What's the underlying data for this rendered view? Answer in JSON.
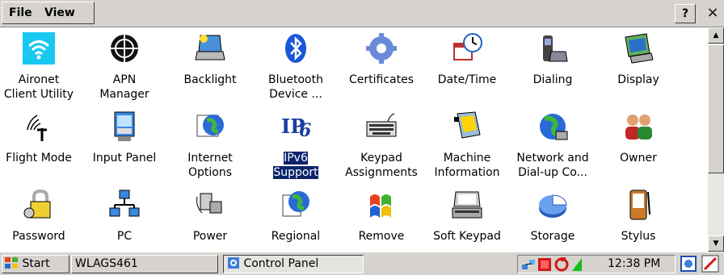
{
  "menubar": {
    "file": "File",
    "view": "View",
    "help": "?",
    "close": "×"
  },
  "items": [
    {
      "label": "Aironet\nClient Utility",
      "icon": "wifi-icon",
      "selected": false
    },
    {
      "label": "APN\nManager",
      "icon": "apn-globe-icon",
      "selected": false
    },
    {
      "label": "Backlight",
      "icon": "backlight-laptop-icon",
      "selected": false
    },
    {
      "label": "Bluetooth\nDevice ...",
      "icon": "bluetooth-icon",
      "selected": false
    },
    {
      "label": "Certificates",
      "icon": "certificates-gear-icon",
      "selected": false
    },
    {
      "label": "Date/Time",
      "icon": "date-time-clock-icon",
      "selected": false
    },
    {
      "label": "Dialing",
      "icon": "dialing-phone-icon",
      "selected": false
    },
    {
      "label": "Display",
      "icon": "display-monitor-icon",
      "selected": false
    },
    {
      "label": "Flight Mode",
      "icon": "flight-mode-antenna-icon",
      "selected": false
    },
    {
      "label": "Input Panel",
      "icon": "input-panel-icon",
      "selected": false
    },
    {
      "label": "Internet\nOptions",
      "icon": "internet-options-globe-icon",
      "selected": false
    },
    {
      "label": "IPv6\nSupport",
      "icon": "ipv6-icon",
      "selected": true
    },
    {
      "label": "Keypad\nAssignments",
      "icon": "keypad-keyboard-icon",
      "selected": false
    },
    {
      "label": "Machine\nInformation",
      "icon": "machine-information-icon",
      "selected": false
    },
    {
      "label": "Network and\nDial-up Co...",
      "icon": "network-globe-icon",
      "selected": false
    },
    {
      "label": "Owner",
      "icon": "owner-people-icon",
      "selected": false
    },
    {
      "label": "Password",
      "icon": "password-lock-icon",
      "selected": false
    },
    {
      "label": "PC",
      "icon": "pc-network-icon",
      "selected": false
    },
    {
      "label": "Power",
      "icon": "power-plug-icon",
      "selected": false
    },
    {
      "label": "Regional",
      "icon": "regional-globe-icon",
      "selected": false
    },
    {
      "label": "Remove",
      "icon": "remove-programs-icon",
      "selected": false
    },
    {
      "label": "Soft Keypad",
      "icon": "soft-keypad-icon",
      "selected": false
    },
    {
      "label": "Storage",
      "icon": "storage-pie-icon",
      "selected": false
    },
    {
      "label": "Stylus",
      "icon": "stylus-device-icon",
      "selected": false
    }
  ],
  "taskbar": {
    "start": "Start",
    "device_name": "WLAGS461",
    "active_window": "Control Panel",
    "clock": "12:38 PM"
  },
  "colors": {
    "selection": "#0a246a",
    "chrome": "#d6d3ce",
    "aironet_bg": "#19c8f0"
  }
}
